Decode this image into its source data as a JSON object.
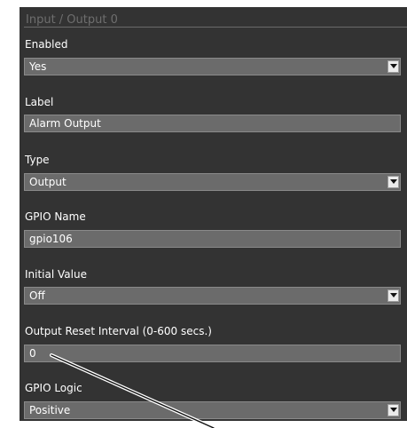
{
  "section": {
    "title": "Input / Output 0"
  },
  "fields": {
    "enabled": {
      "label": "Enabled",
      "value": "Yes",
      "icon": "chevron-down-icon"
    },
    "label": {
      "label": "Label",
      "value": "Alarm Output"
    },
    "type": {
      "label": "Type",
      "value": "Output",
      "icon": "chevron-down-icon"
    },
    "gpio_name": {
      "label": "GPIO Name",
      "value": "gpio106"
    },
    "initial_value": {
      "label": "Initial Value",
      "value": "Off",
      "icon": "chevron-down-icon"
    },
    "reset_interval": {
      "label": "Output Reset Interval (0-600 secs.)",
      "value": "0"
    },
    "gpio_logic": {
      "label": "GPIO Logic",
      "value": "Positive",
      "icon": "chevron-down-icon"
    }
  },
  "colors": {
    "panel_bg": "#333333",
    "field_bg": "#6b6b6b",
    "text": "#ffffff",
    "section_title": "#6e6e6e"
  }
}
